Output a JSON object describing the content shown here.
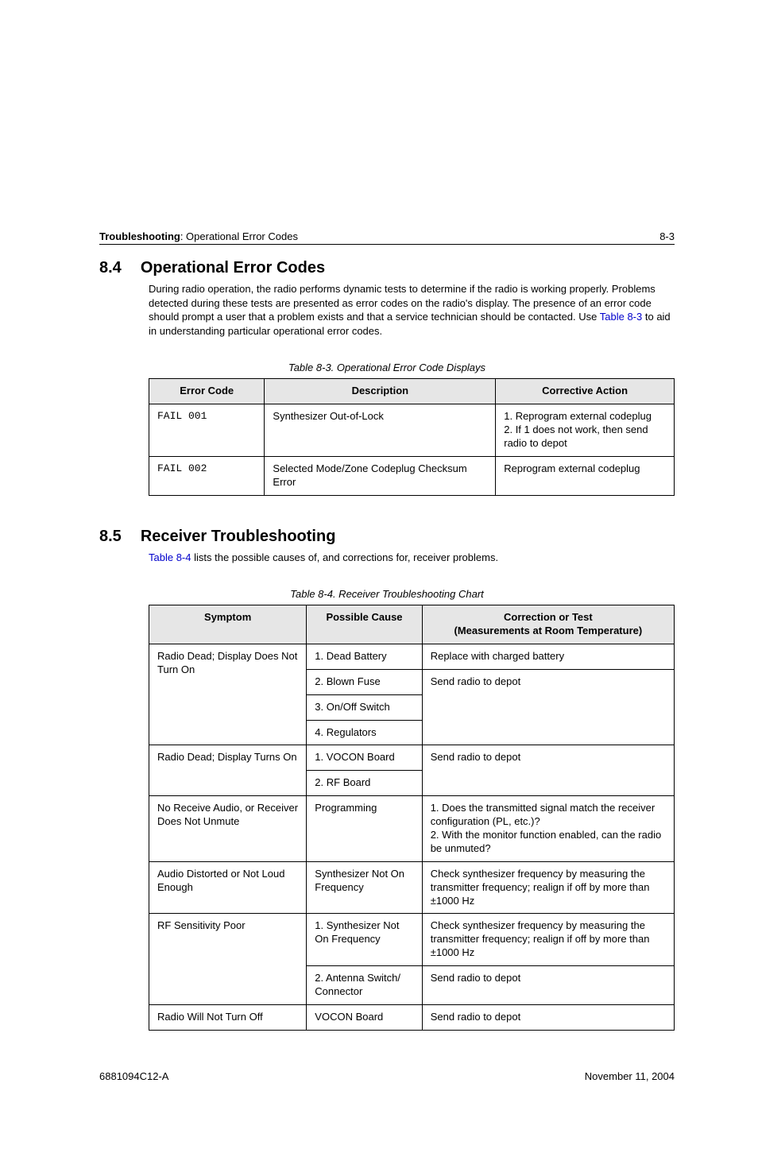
{
  "header": {
    "left_bold": "Troubleshooting",
    "left_rest": ": Operational Error Codes",
    "page_num": "8-3"
  },
  "section84": {
    "number": "8.4",
    "title": "Operational Error Codes",
    "para_pre": "During radio operation, the radio performs dynamic tests to determine if the radio is working properly. Problems detected during these tests are presented as error codes on the radio's display. The presence of an error code should prompt a user that a problem exists and that a service technician should be contacted. Use ",
    "para_link": "Table 8-3",
    "para_post": " to aid in understanding particular operational error codes."
  },
  "table83": {
    "caption": "Table 8-3.  Operational Error Code Displays",
    "headers": [
      "Error Code",
      "Description",
      "Corrective Action"
    ],
    "rows": [
      {
        "code": "FAIL 001",
        "desc": "Synthesizer Out-of-Lock",
        "action": "1. Reprogram external codeplug\n2. If 1 does not work, then send radio to depot"
      },
      {
        "code": "FAIL 002",
        "desc": "Selected Mode/Zone Codeplug Checksum Error",
        "action": "Reprogram external codeplug"
      }
    ]
  },
  "section85": {
    "number": "8.5",
    "title": "Receiver Troubleshooting",
    "para_link": "Table 8-4",
    "para_post": " lists the possible causes of, and corrections for, receiver problems."
  },
  "table84": {
    "caption": "Table 8-4.  Receiver Troubleshooting Chart",
    "headers": {
      "c1": "Symptom",
      "c2": "Possible Cause",
      "c3a": "Correction or Test",
      "c3b": "(Measurements at Room Temperature)"
    },
    "rows": [
      {
        "symptom": "Radio Dead; Display Does Not Turn On",
        "cause": "1. Dead Battery",
        "correction": "Replace with charged battery"
      },
      {
        "cause": "2. Blown Fuse",
        "correction": "Send radio to depot"
      },
      {
        "cause": "3. On/Off Switch"
      },
      {
        "cause": "4. Regulators"
      },
      {
        "symptom": "Radio Dead; Display Turns On",
        "cause": "1. VOCON Board",
        "correction": "Send radio to depot"
      },
      {
        "cause": "2. RF Board"
      },
      {
        "symptom": "No Receive Audio, or Receiver Does Not Unmute",
        "cause": "Programming",
        "correction": "1. Does the transmitted signal match the receiver configuration (PL, etc.)?\n2. With the monitor function enabled, can the radio be unmuted?"
      },
      {
        "symptom": "Audio Distorted or Not Loud Enough",
        "cause": "Synthesizer Not On Frequency",
        "correction": "Check synthesizer frequency by measuring the transmitter frequency; realign if off by more than ±1000 Hz"
      },
      {
        "symptom": "RF Sensitivity Poor",
        "cause": "1. Synthesizer Not On Frequency",
        "correction": "Check synthesizer frequency by measuring the transmitter frequency; realign if off by more than ±1000 Hz"
      },
      {
        "cause": "2. Antenna Switch/ Connector",
        "correction": "Send radio to depot"
      },
      {
        "symptom": "Radio Will Not Turn Off",
        "cause": "VOCON Board",
        "correction": "Send radio to depot"
      }
    ]
  },
  "footer": {
    "left": "6881094C12-A",
    "right": "November 11, 2004"
  },
  "chart_data": [
    {
      "type": "table",
      "title": "Operational Error Code Displays",
      "columns": [
        "Error Code",
        "Description",
        "Corrective Action"
      ],
      "rows": [
        [
          "FAIL 001",
          "Synthesizer Out-of-Lock",
          "1. Reprogram external codeplug; 2. If 1 does not work, then send radio to depot"
        ],
        [
          "FAIL 002",
          "Selected Mode/Zone Codeplug Checksum Error",
          "Reprogram external codeplug"
        ]
      ]
    },
    {
      "type": "table",
      "title": "Receiver Troubleshooting Chart",
      "columns": [
        "Symptom",
        "Possible Cause",
        "Correction or Test (Measurements at Room Temperature)"
      ],
      "rows": [
        [
          "Radio Dead; Display Does Not Turn On",
          "1. Dead Battery",
          "Replace with charged battery"
        ],
        [
          "Radio Dead; Display Does Not Turn On",
          "2. Blown Fuse",
          "Send radio to depot"
        ],
        [
          "Radio Dead; Display Does Not Turn On",
          "3. On/Off Switch",
          "Send radio to depot"
        ],
        [
          "Radio Dead; Display Does Not Turn On",
          "4. Regulators",
          "Send radio to depot"
        ],
        [
          "Radio Dead; Display Turns On",
          "1. VOCON Board",
          "Send radio to depot"
        ],
        [
          "Radio Dead; Display Turns On",
          "2. RF Board",
          "Send radio to depot"
        ],
        [
          "No Receive Audio, or Receiver Does Not Unmute",
          "Programming",
          "1. Does the transmitted signal match the receiver configuration (PL, etc.)? 2. With the monitor function enabled, can the radio be unmuted?"
        ],
        [
          "Audio Distorted or Not Loud Enough",
          "Synthesizer Not On Frequency",
          "Check synthesizer frequency by measuring the transmitter frequency; realign if off by more than ±1000 Hz"
        ],
        [
          "RF Sensitivity Poor",
          "1. Synthesizer Not On Frequency",
          "Check synthesizer frequency by measuring the transmitter frequency; realign if off by more than ±1000 Hz"
        ],
        [
          "RF Sensitivity Poor",
          "2. Antenna Switch/ Connector",
          "Send radio to depot"
        ],
        [
          "Radio Will Not Turn Off",
          "VOCON Board",
          "Send radio to depot"
        ]
      ]
    }
  ]
}
